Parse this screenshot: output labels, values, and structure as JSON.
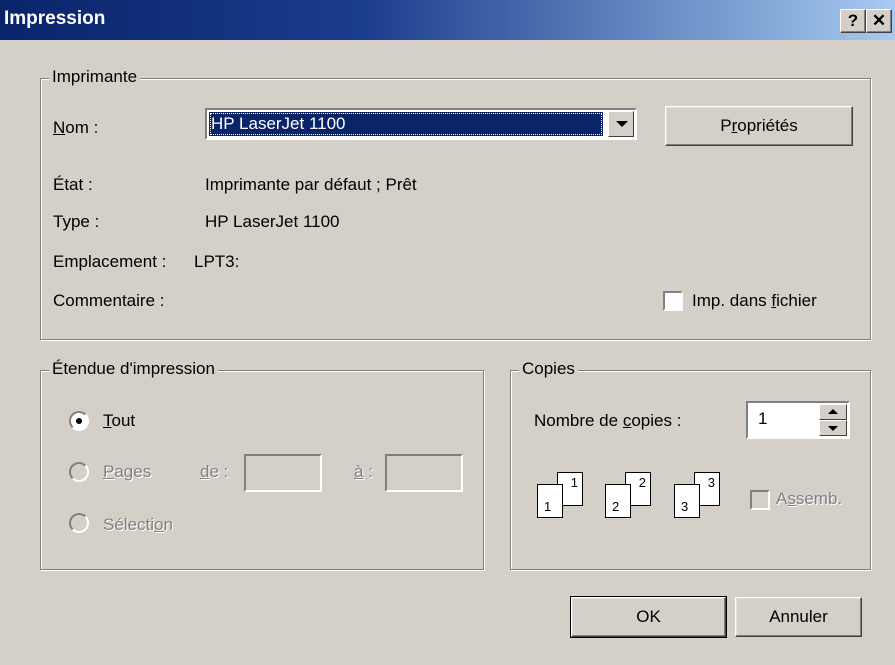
{
  "window": {
    "title": "Impression",
    "help_glyph": "?",
    "close_glyph": "✕"
  },
  "printer": {
    "group_label": "Imprimante",
    "name_label": "Nom :",
    "name_value": "HP LaserJet 1100",
    "properties_button": "Propriétés",
    "status_label": "État :",
    "status_value": "Imprimante par défaut ; Prêt",
    "type_label": "Type :",
    "type_value": "HP LaserJet 1100",
    "location_label": "Emplacement :",
    "location_value": "LPT3:",
    "comment_label": "Commentaire :",
    "print_to_file_label": "Imp. dans fichier",
    "print_to_file_checked": false
  },
  "range": {
    "group_label": "Étendue d'impression",
    "all_label": "Tout",
    "pages_label": "Pages",
    "from_label": "de :",
    "to_label": "à :",
    "selection_label": "Sélection",
    "selected": "all"
  },
  "copies": {
    "group_label": "Copies",
    "count_label": "Nombre de copies :",
    "count_value": "1",
    "collate_label": "Assemb.",
    "collate_checked": false,
    "collate_icons": [
      {
        "back": "1",
        "front": "1"
      },
      {
        "back": "2",
        "front": "2"
      },
      {
        "back": "3",
        "front": "3"
      }
    ]
  },
  "buttons": {
    "ok": "OK",
    "cancel": "Annuler"
  }
}
